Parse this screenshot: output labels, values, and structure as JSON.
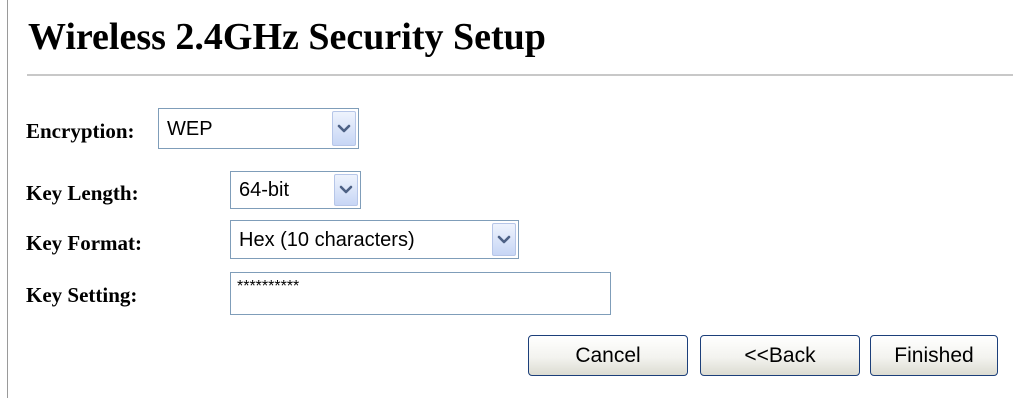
{
  "page": {
    "title": "Wireless 2.4GHz Security Setup"
  },
  "form": {
    "encryption": {
      "label": "Encryption:",
      "value": "WEP"
    },
    "key_length": {
      "label": "Key Length:",
      "value": "64-bit"
    },
    "key_format": {
      "label": "Key Format:",
      "value": "Hex (10 characters)"
    },
    "key_setting": {
      "label": "Key Setting:",
      "value": "**********"
    }
  },
  "buttons": {
    "cancel": "Cancel",
    "back": "<<Back",
    "finished": "Finished"
  },
  "icons": {
    "dropdown": "chevron-down-icon"
  },
  "colors": {
    "input_border": "#7f9db9",
    "button_border": "#1c3f7a",
    "dropdown_arrow": "#4d6185",
    "title_rule": "#c8c8c8"
  }
}
